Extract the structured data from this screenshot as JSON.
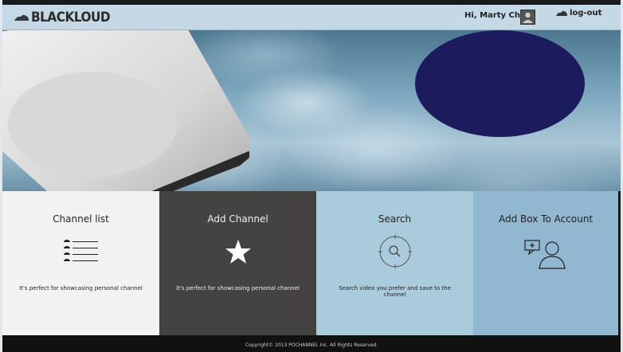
{
  "header": {
    "logo_text": "BLACKLOUD",
    "greeting": "Hi, Marty Chao",
    "logout_label": "log-out"
  },
  "tiles": [
    {
      "title": "Channel list",
      "desc": "It's perfect for showcasing personal channel",
      "icon": "list-icon"
    },
    {
      "title": "Add Channel",
      "desc": "It's perfect for showcasing personal channel",
      "icon": "star-icon"
    },
    {
      "title": "Search",
      "desc": "Search video you prefer and save to the channel",
      "icon": "search-icon"
    },
    {
      "title": "Add Box To Account",
      "desc": "",
      "icon": "add-user-icon"
    }
  ],
  "footer": {
    "copyright": "Copyright© 2013 POCHANNEL Inc. All Rights Reserved."
  },
  "colors": {
    "topbar": "#c4d8e6",
    "tile1": "#f2f2f2",
    "tile2": "#454341",
    "tile3": "#a9cbdc",
    "tile4": "#91b7d1",
    "redaction": "#1b1b5e"
  }
}
